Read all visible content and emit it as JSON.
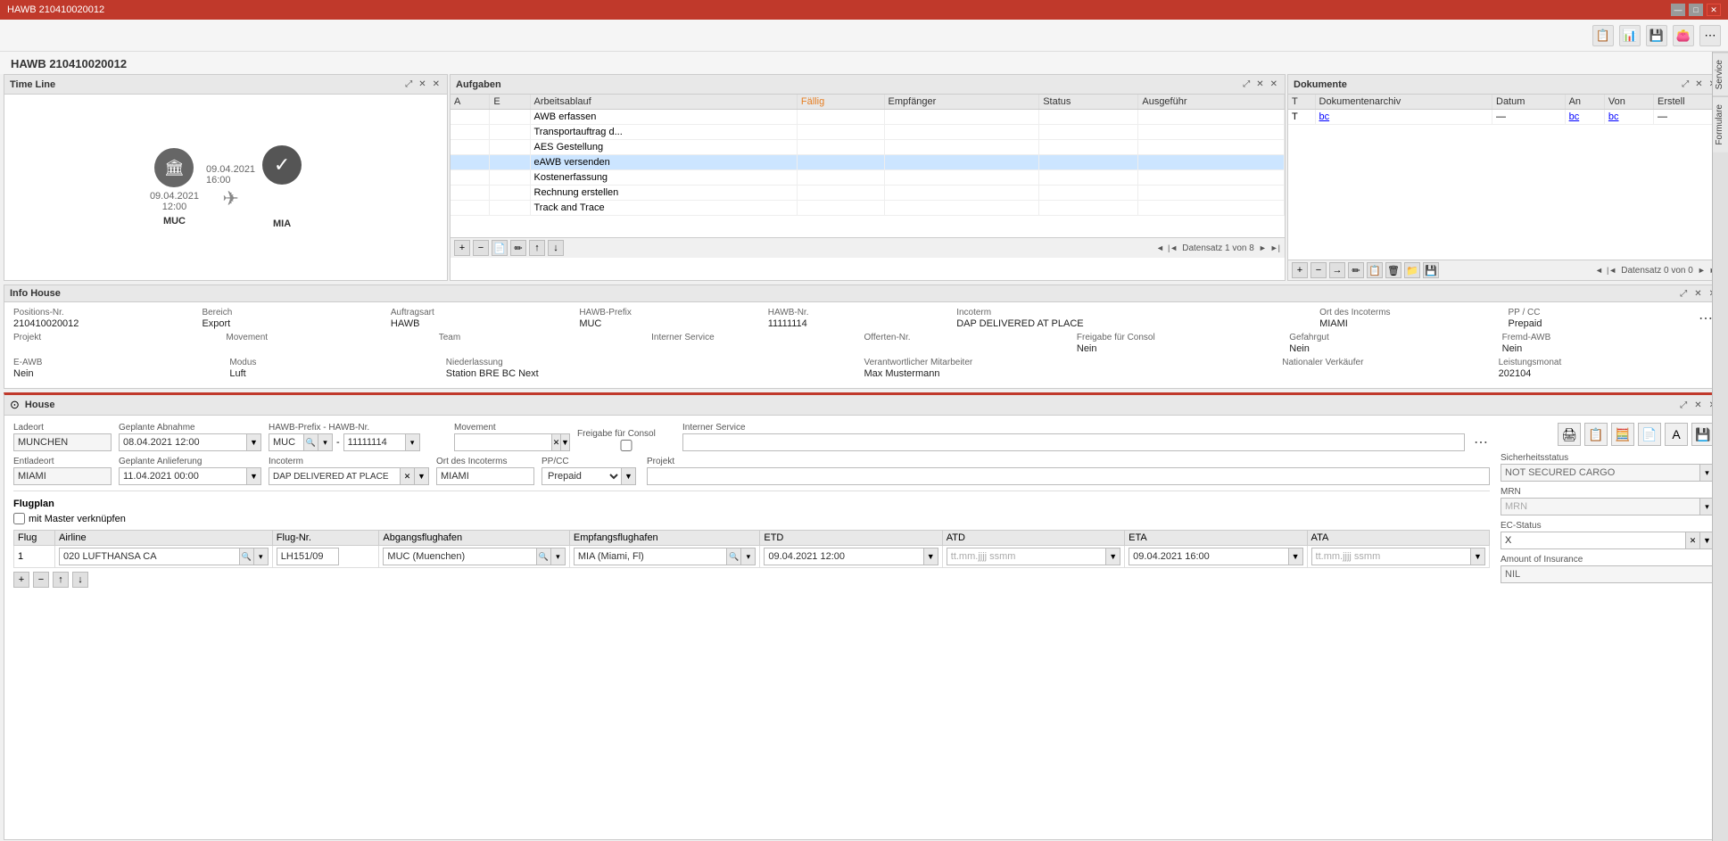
{
  "titleBar": {
    "title": "HAWB 210410020012",
    "minBtn": "—",
    "maxBtn": "□",
    "closeBtn": "✕"
  },
  "pageTitle": "HAWB 210410020012",
  "topToolbar": {
    "icons": [
      "📋",
      "📊",
      "💾",
      "👛",
      "⋯"
    ]
  },
  "rightSidebar": {
    "tabs": [
      "Service",
      "Formulare"
    ]
  },
  "timeline": {
    "title": "Time Line",
    "from": {
      "icon": "🏛",
      "code": "MUC",
      "date": "09.04.2021",
      "time": "12:00"
    },
    "to": {
      "icon": "✓",
      "code": "MIA",
      "date": "09.04.2021",
      "time": "16:00"
    }
  },
  "aufgaben": {
    "title": "Aufgaben",
    "columns": [
      "A",
      "E",
      "Arbeitsablauf",
      "Fällig",
      "Empfänger",
      "Status",
      "Ausgeführ"
    ],
    "rows": [
      {
        "col_a": "",
        "col_e": "",
        "arbeitsablauf": "AWB erfassen",
        "fallig": "",
        "empfanger": "",
        "status": "",
        "ausgefuhrt": ""
      },
      {
        "col_a": "",
        "col_e": "",
        "arbeitsablauf": "Transportauftrag d...",
        "fallig": "",
        "empfanger": "",
        "status": "",
        "ausgefuhrt": ""
      },
      {
        "col_a": "",
        "col_e": "",
        "arbeitsablauf": "AES Gestellung",
        "fallig": "",
        "empfanger": "",
        "status": "",
        "ausgefuhrt": ""
      },
      {
        "col_a": "",
        "col_e": "",
        "arbeitsablauf": "eAWB versenden",
        "fallig": "",
        "empfanger": "",
        "status": "",
        "ausgefuhrt": ""
      },
      {
        "col_a": "",
        "col_e": "",
        "arbeitsablauf": "Kostenerfassung",
        "fallig": "",
        "empfanger": "",
        "status": "",
        "ausgefuhrt": ""
      },
      {
        "col_a": "",
        "col_e": "",
        "arbeitsablauf": "Rechnung erstellen",
        "fallig": "",
        "empfanger": "",
        "status": "",
        "ausgefuhrt": ""
      },
      {
        "col_a": "",
        "col_e": "",
        "arbeitsablauf": "Track and Trace",
        "fallig": "",
        "empfanger": "",
        "status": "",
        "ausgefuhrt": ""
      }
    ],
    "nav": "Datensatz 1 von 8",
    "actions": [
      "+",
      "−",
      "📄",
      "✏",
      "↑",
      "↓"
    ]
  },
  "dokumente": {
    "title": "Dokumente",
    "columns": [
      "T",
      "Dokumentenarchiv",
      "Datum",
      "An",
      "Von",
      "Erstell"
    ],
    "rows": [],
    "nav": "Datensatz 0 von 0",
    "actions": [
      "+",
      "−",
      "→",
      "✏",
      "📋",
      "🗑",
      "📁",
      "💾"
    ]
  },
  "infoHouse": {
    "title": "Info House",
    "fields": {
      "positionsNr": {
        "label": "Positions-Nr.",
        "value": "210410020012"
      },
      "bereich": {
        "label": "Bereich",
        "value": "Export"
      },
      "auftragsart": {
        "label": "Auftragsart",
        "value": "HAWB"
      },
      "hawbPrefix": {
        "label": "HAWB-Prefix",
        "value": "MUC"
      },
      "hawbNr": {
        "label": "HAWB-Nr.",
        "value": "11111114"
      },
      "incoterm": {
        "label": "Incoterm",
        "value": "DAP DELIVERED AT PLACE"
      },
      "ortDesIncoterms": {
        "label": "Ort des Incoterms",
        "value": "MIAMI"
      },
      "ppCc": {
        "label": "PP / CC",
        "value": "Prepaid"
      },
      "projekt": {
        "label": "Projekt",
        "value": ""
      },
      "movement": {
        "label": "Movement",
        "value": ""
      },
      "team": {
        "label": "Team",
        "value": ""
      },
      "internerService": {
        "label": "Interner Service",
        "value": ""
      },
      "offertenNr": {
        "label": "Offerten-Nr.",
        "value": ""
      },
      "freigabeConsol": {
        "label": "Freigabe für Consol",
        "value": "Nein"
      },
      "gefahrgut": {
        "label": "Gefahrgut",
        "value": "Nein"
      },
      "fremdAwb": {
        "label": "Fremd-AWB",
        "value": "Nein"
      },
      "eAwb": {
        "label": "E-AWB",
        "value": "Nein"
      },
      "modus": {
        "label": "Modus",
        "value": "Luft"
      },
      "niederlassung": {
        "label": "Niederlassung",
        "value": "Station BRE BC Next"
      },
      "verantwMitarbeiter": {
        "label": "Verantwortlicher Mitarbeiter",
        "value": "Max Mustermann"
      },
      "nationalerVerkaufer": {
        "label": "Nationaler Verkäufer",
        "value": ""
      },
      "leistungsmonat": {
        "label": "Leistungsmonat",
        "value": "202104"
      }
    }
  },
  "house": {
    "title": "House",
    "ladeort": {
      "label": "Ladeort",
      "value": "MUNCHEN"
    },
    "geplante_abnahme": {
      "label": "Geplante Abnahme",
      "value": "08.04.2021 12:00"
    },
    "hawb_prefix": {
      "label": "HAWB-Prefix - HAWB-Nr.",
      "prefix": "MUC",
      "nr": "11111114"
    },
    "movement": {
      "label": "Movement",
      "value": ""
    },
    "freigabe_consol": {
      "label": "Freigabe für Consol",
      "value": false
    },
    "interner_service": {
      "label": "Interner Service",
      "value": ""
    },
    "entladeort": {
      "label": "Entladeort",
      "value": "MIAMI"
    },
    "geplante_anlieferung": {
      "label": "Geplante Anlieferung",
      "value": "11.04.2021 00:00"
    },
    "incoterm": {
      "label": "Incoterm",
      "value": "DAP DELIVERED AT PLACE"
    },
    "ort_des_incoterms": {
      "label": "Ort des Incoterms",
      "value": "MIAMI"
    },
    "pp_cc": {
      "label": "PP/CC",
      "value": "Prepaid"
    },
    "projekt": {
      "label": "Projekt",
      "value": ""
    },
    "sicherheitsstatus": {
      "label": "Sicherheitsstatus",
      "value": "NOT SECURED CARGO"
    },
    "mrn": {
      "label": "MRN",
      "value": "MRN"
    },
    "ec_status": {
      "label": "EC-Status",
      "value": "X"
    },
    "amount_insurance": {
      "label": "Amount of Insurance",
      "value": "NIL"
    },
    "flugplan": {
      "title": "Flugplan",
      "mit_master": "mit Master verknüpfen",
      "columns": [
        "Flug",
        "Airline",
        "Flug-Nr.",
        "Abgangsflughafen",
        "Empfangsflughafen",
        "ETD",
        "ATD",
        "ETA",
        "ATA"
      ],
      "rows": [
        {
          "flug": "1",
          "airline": "020 LUFTHANSA CA",
          "flug_nr": "LH151/09",
          "abgangs": "MUC (Muenchen)",
          "empfangs": "MIA (Miami, Fl)",
          "etd": "09.04.2021 12:00",
          "atd": "tt.mm.jjjj ssmm",
          "eta": "09.04.2021 16:00",
          "ata": "tt.mm.jjjj ssmm"
        }
      ]
    }
  }
}
